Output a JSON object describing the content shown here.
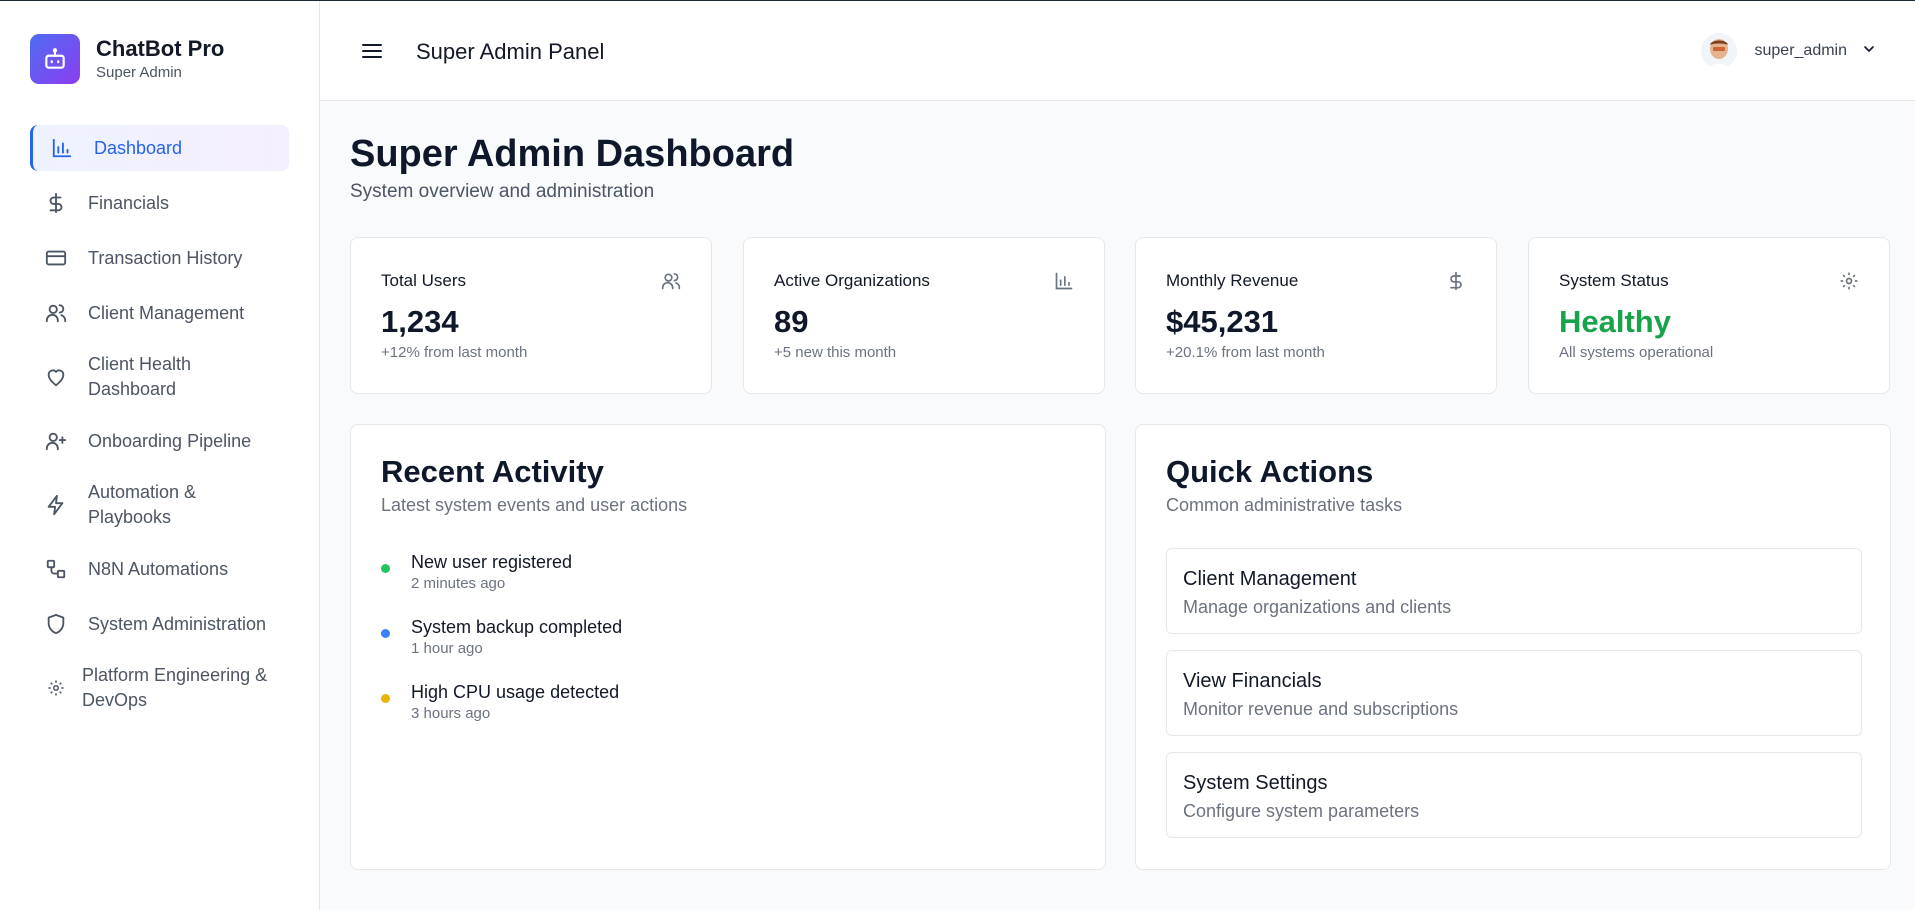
{
  "brand": {
    "name": "ChatBot Pro",
    "subtitle": "Super Admin"
  },
  "sidebar": {
    "items": [
      {
        "label": "Dashboard",
        "icon": "bar-chart-icon",
        "active": true
      },
      {
        "label": "Financials",
        "icon": "dollar-icon"
      },
      {
        "label": "Transaction History",
        "icon": "credit-card-icon"
      },
      {
        "label": "Client Management",
        "icon": "users-icon"
      },
      {
        "label": "Client Health\nDashboard",
        "icon": "heart-icon"
      },
      {
        "label": "Onboarding Pipeline",
        "icon": "user-plus-icon"
      },
      {
        "label": "Automation &\nPlaybooks",
        "icon": "lightning-icon"
      },
      {
        "label": "N8N Automations",
        "icon": "workflow-icon"
      },
      {
        "label": "System Administration",
        "icon": "shield-icon"
      },
      {
        "label": "Platform Engineering &\nDevOps",
        "icon": "gear-icon"
      }
    ]
  },
  "header": {
    "title": "Super Admin Panel",
    "username": "super_admin"
  },
  "main": {
    "title": "Super Admin Dashboard",
    "subtitle": "System overview and administration",
    "stats": [
      {
        "label": "Total Users",
        "value": "1,234",
        "note": "+12% from last month",
        "icon": "users-icon"
      },
      {
        "label": "Active Organizations",
        "value": "89",
        "note": "+5 new this month",
        "icon": "bar-chart-icon"
      },
      {
        "label": "Monthly Revenue",
        "value": "$45,231",
        "note": "+20.1% from last month",
        "icon": "dollar-icon"
      },
      {
        "label": "System Status",
        "value": "Healthy",
        "note": "All systems operational",
        "icon": "gear-icon",
        "value_color": "#16a34a"
      }
    ],
    "recent_activity": {
      "title": "Recent Activity",
      "subtitle": "Latest system events and user actions",
      "items": [
        {
          "title": "New user registered",
          "time": "2 minutes ago",
          "color": "#22c55e"
        },
        {
          "title": "System backup completed",
          "time": "1 hour ago",
          "color": "#3b82f6"
        },
        {
          "title": "High CPU usage detected",
          "time": "3 hours ago",
          "color": "#eab308"
        }
      ]
    },
    "quick_actions": {
      "title": "Quick Actions",
      "subtitle": "Common administrative tasks",
      "items": [
        {
          "title": "Client Management",
          "subtitle": "Manage organizations and clients"
        },
        {
          "title": "View Financials",
          "subtitle": "Monitor revenue and subscriptions"
        },
        {
          "title": "System Settings",
          "subtitle": "Configure system parameters"
        }
      ]
    }
  }
}
